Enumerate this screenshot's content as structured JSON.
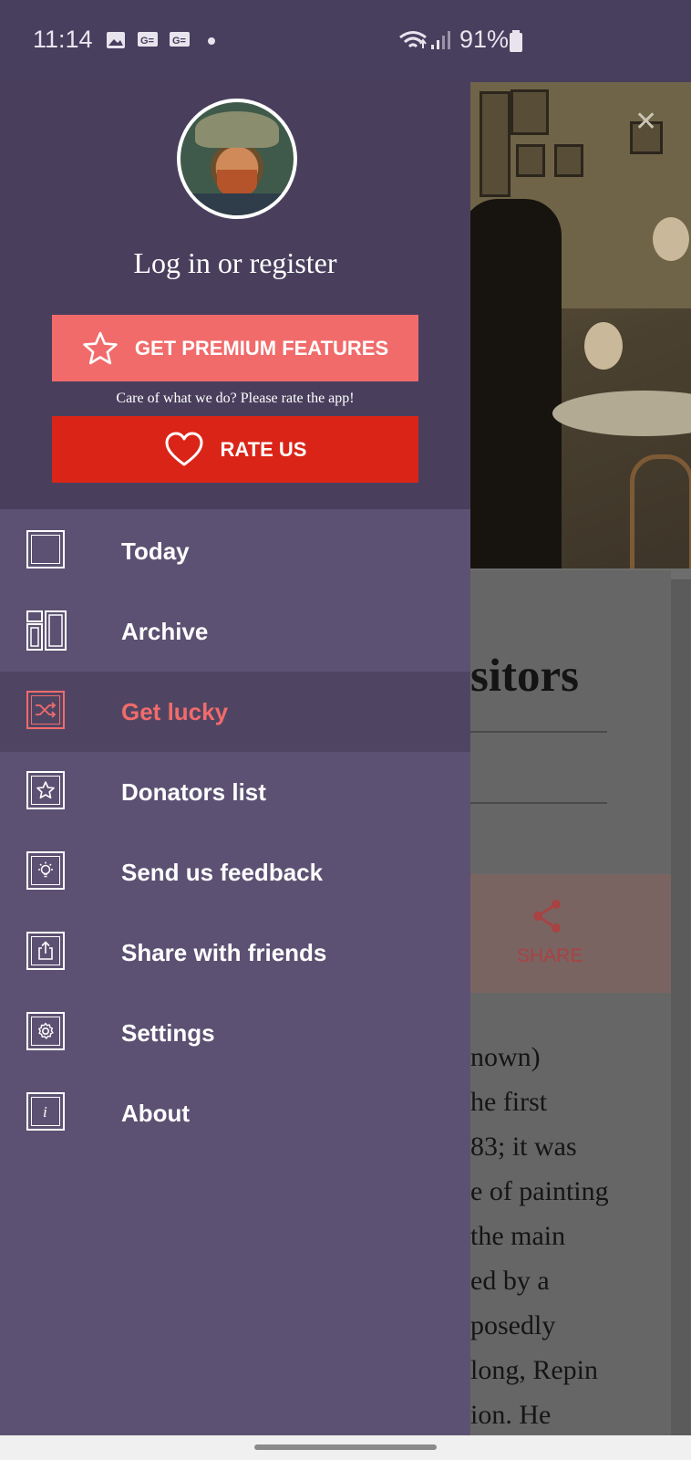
{
  "status_bar": {
    "time": "11:14",
    "battery": "91%",
    "icons": [
      "image-icon",
      "news-icon",
      "news-icon",
      "dot-icon",
      "wifi-icon",
      "signal-icon",
      "battery-icon"
    ]
  },
  "drawer": {
    "login_text": "Log in or register",
    "premium_label": "GET PREMIUM FEATURES",
    "rate_hint": "Care of what we do? Please rate the app!",
    "rate_label": "RATE US",
    "menu": [
      {
        "label": "Today",
        "icon": "square-icon",
        "active": false
      },
      {
        "label": "Archive",
        "icon": "archive-icon",
        "active": false
      },
      {
        "label": "Get lucky",
        "icon": "shuffle-icon",
        "active": true
      },
      {
        "label": "Donators list",
        "icon": "star-icon",
        "active": false
      },
      {
        "label": "Send us feedback",
        "icon": "lightbulb-icon",
        "active": false
      },
      {
        "label": "Share with friends",
        "icon": "share-upload-icon",
        "active": false
      },
      {
        "label": "Settings",
        "icon": "gear-icon",
        "active": false
      },
      {
        "label": "About",
        "icon": "info-icon",
        "active": false
      }
    ]
  },
  "background_article": {
    "title_fragment": "sitors",
    "share_label": "SHARE",
    "body_lines": [
      "nown)",
      "he first",
      "83; it was",
      "e of painting",
      "the main",
      "ed by a",
      "posedly",
      "long, Repin",
      "ion. He"
    ]
  },
  "colors": {
    "header_bg": "#493f5d",
    "drawer_bg": "#5c5172",
    "accent": "#f16b6b",
    "rate_red": "#da2418"
  }
}
